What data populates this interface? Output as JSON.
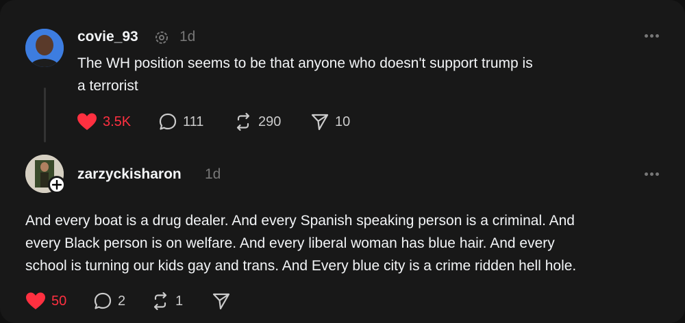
{
  "post1": {
    "username": "covie_93",
    "badge_icon": "threads-activity-icon",
    "time": "1d",
    "text_line1": "The WH position seems to be that anyone who doesn't support trump is",
    "text_line2": "a terrorist",
    "likes": "3.5K",
    "comments": "111",
    "reposts": "290",
    "shares": "10"
  },
  "post2": {
    "username": "zarzyckisharon",
    "time": "1d",
    "text_line1": "And every boat is a drug dealer. And every Spanish speaking person is a criminal. And",
    "text_line2": "every Black person is on welfare. And every liberal woman has blue hair. And every",
    "text_line3": "school is turning our kids gay and trans. And Every blue city is a crime ridden hell hole.",
    "likes": "50",
    "comments": "2",
    "reposts": "1"
  },
  "colors": {
    "background": "#181818",
    "like_red": "#ff3040",
    "muted": "#777777"
  }
}
